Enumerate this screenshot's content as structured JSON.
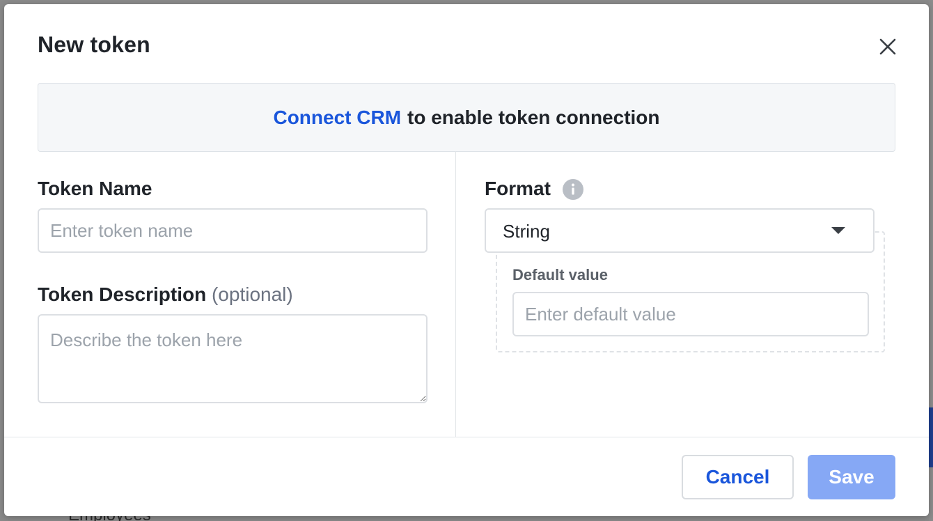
{
  "background": {
    "partial_text": "Employees"
  },
  "modal": {
    "title": "New token",
    "notice": {
      "link_text": "Connect CRM",
      "text": "to enable token connection"
    },
    "token_name": {
      "label": "Token Name",
      "placeholder": "Enter token name",
      "value": ""
    },
    "token_description": {
      "label": "Token Description",
      "optional_label": "(optional)",
      "placeholder": "Describe the token here",
      "value": ""
    },
    "format": {
      "label": "Format",
      "selected": "String",
      "info_icon": "info-circle-icon"
    },
    "default_value": {
      "label": "Default value",
      "placeholder": "Enter default value",
      "value": ""
    },
    "footer": {
      "cancel_label": "Cancel",
      "save_label": "Save"
    }
  },
  "colors": {
    "accent": "#1a56db",
    "save_disabled": "#86a8f5",
    "text_primary": "#1f2329",
    "placeholder": "#9ca3ab",
    "notice_bg": "#f5f7f9"
  }
}
